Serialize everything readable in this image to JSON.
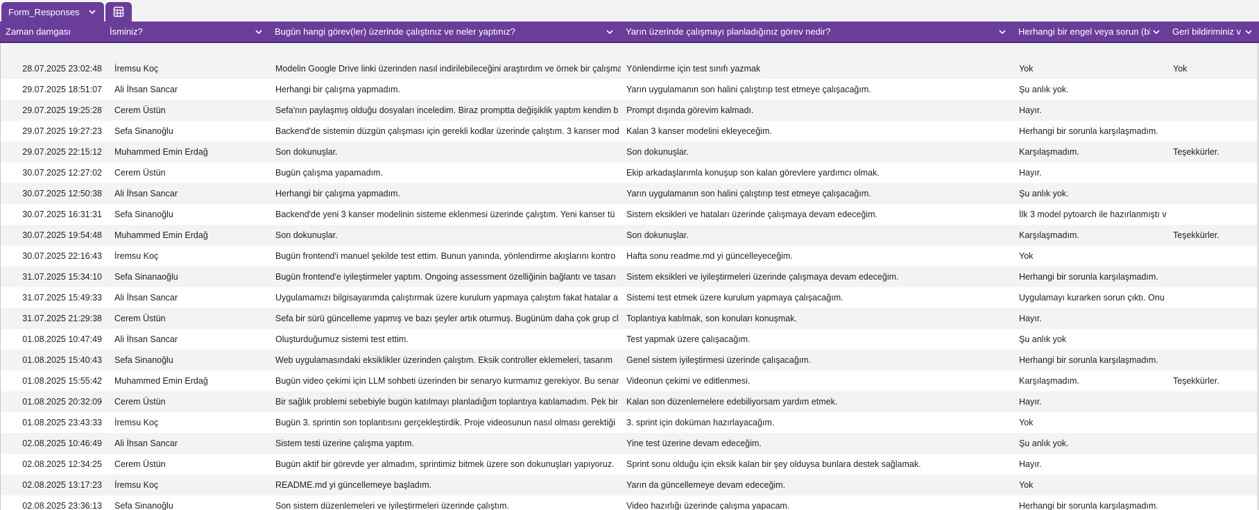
{
  "tab": {
    "name": "Form_Responses",
    "chevron_icon": "chevron-down-icon",
    "view_icon": "table-grid-icon"
  },
  "columns": [
    "Zaman damgası",
    "İsminiz?",
    "Bugün hangi görev(ler) üzerinde çalıştınız ve neler yaptınız?",
    "Yarın üzerinde çalışmayı planladığınız görev nedir?",
    "Herhangi bir engel veya sorun (bl",
    "Geri bildiriminiz v"
  ],
  "rows": [
    [
      "",
      "",
      "",
      "",
      "",
      ""
    ],
    [
      "28.07.2025 23:02:48",
      "İremsu Koç",
      "Modelin Google Drive linki üzerinden nasıl indirilebileceğini araştırdım ve örnek bir çalışma",
      "Yönlendirme için test sınıfı yazmak",
      "Yok",
      "Yok"
    ],
    [
      "29.07.2025 18:51:07",
      "Ali İhsan Sancar",
      "Herhangi bir çalışma yapmadım.",
      "Yarın uygulamanın son halini çalıştırıp test etmeye çalışacağım.",
      "Şu anlık yok.",
      ""
    ],
    [
      "29.07.2025 19:25:28",
      "Cerem Üstün",
      "Sefa'nın paylaşmış olduğu dosyaları inceledim. Biraz promptta değişiklik yaptım kendim b",
      "Prompt dışında görevim kalmadı.",
      "Hayır.",
      ""
    ],
    [
      "29.07.2025 19:27:23",
      "Sefa Sinanoğlu",
      "Backend'de sistemin düzgün çalışması için gerekli kodlar üzerinde çalıştım. 3 kanser mod",
      "Kalan 3 kanser modelini ekleyeceğim.",
      "Herhangi bir sorunla karşılaşmadım.",
      ""
    ],
    [
      "29.07.2025 22:15:12",
      "Muhammed Emin Erdağ",
      "Son dokunuşlar.",
      "Son dokunuşlar.",
      "Karşılaşmadım.",
      "Teşekkürler."
    ],
    [
      "30.07.2025 12:27:02",
      "Cerem Üstün",
      "Bugün çalışma yapamadım.",
      "Ekip arkadaşlarımla konuşup son kalan görevlere yardımcı olmak.",
      "Hayır.",
      ""
    ],
    [
      "30.07.2025 12:50:38",
      "Ali İhsan Sancar",
      "Herhangi bir çalışma yapmadım.",
      "Yarın uygulamanın son halini çalıştırıp test etmeye çalışacağım.",
      "Şu anlık yok.",
      ""
    ],
    [
      "30.07.2025 16:31:31",
      "Sefa Sinanoğlu",
      "Backend'de yeni 3 kanser modelinin sisteme eklenmesi üzerinde çalıştım. Yeni kanser tü",
      "Sistem eksikleri ve hataları üzerinde çalışmaya devam edeceğim.",
      "İlk 3 model pytoarch ile hazırlanmıştı v",
      ""
    ],
    [
      "30.07.2025 19:54:48",
      "Muhammed Emin Erdağ",
      "Son dokunuşlar.",
      "Son dokunuşlar.",
      "Karşılaşmadım.",
      "Teşekkürler."
    ],
    [
      "30.07.2025 22:16:43",
      "İremsu Koç",
      "Bugün frontend'i manuel şekilde test ettim. Bunun yanında, yönlendirme akışlarını kontro",
      "Hafta sonu readme.md yi güncelleyeceğim.",
      "Yok",
      ""
    ],
    [
      "31.07.2025 15:34:10",
      "Sefa Sinanaoğlu",
      "Bugün frontend'e iyileştirmeler yaptım. Ongoing assessment özelliğinin bağlantı ve tasarı",
      "Sistem eksikleri ve iyileştirmeleri üzerinde çalışmaya devam edeceğim.",
      "Herhangi bir sorunla karşılaşmadım.",
      ""
    ],
    [
      "31.07.2025 15:49:33",
      "Ali İhsan Sancar",
      "Uygulamamızı bilgisayarımda çalıştırmak üzere kurulum yapmaya çalıştım fakat hatalar a",
      "Sistemi test etmek üzere kurulum yapmaya çalışacağım.",
      "Uygulamayı kurarken sorun çıktı. Onu",
      ""
    ],
    [
      "31.07.2025 21:29:38",
      "Cerem Üstün",
      "Sefa bir sürü güncelleme yapmış ve bazı şeyler artık oturmuş. Bugünüm daha çok grup cl",
      "Toplantıya katılmak, son konuları konuşmak.",
      "Hayır.",
      ""
    ],
    [
      "01.08.2025 10:47:49",
      "Ali İhsan Sancar",
      "Oluşturduğumuz sistemi test ettim.",
      "Test yapmak üzere çalışacağım.",
      "Şu anlık yok",
      ""
    ],
    [
      "01.08.2025 15:40:43",
      "Sefa Sinanoğlu",
      "Web uygulamasındaki eksiklikler üzerinden çalıştım. Eksik controller eklemeleri, tasarım",
      "Genel sistem iyileştirmesi üzerinde çalışacağım.",
      "Herhangi bir sorunla karşılaşmadım.",
      ""
    ],
    [
      "01.08.2025 15:55:42",
      "Muhammed Emin Erdağ",
      "Bugün video çekimi için LLM sohbeti üzerinden bir senaryo kurmamız gerekiyor. Bu senar",
      "Videonun çekimi ve editlenmesi.",
      "Karşılaşmadım.",
      "Teşekkürler."
    ],
    [
      "01.08.2025 20:32:09",
      "Cerem Üstün",
      "Bir sağlık problemi sebebiyle bugün katılmayı planladığım toplantıya katılamadım. Pek bir",
      "Kalan son düzenlemelere edebiliyorsam yardım etmek.",
      "Hayır.",
      ""
    ],
    [
      "01.08.2025 23:43:33",
      "İremsu Koç",
      "Bugün 3. sprintin son toplantısını gerçekleştirdik. Proje videosunun nasıl olması gerektiği",
      "3. sprint için doküman hazırlayacağım.",
      "Yok",
      ""
    ],
    [
      "02.08.2025 10:46:49",
      "Ali İhsan Sancar",
      "Sistem testi üzerine çalışma yaptım.",
      "Yine test üzerine devam edeceğim.",
      "Şu anlık yok.",
      ""
    ],
    [
      "02.08.2025 12:34:25",
      "Cerem Üstün",
      "Bugün aktif bir görevde yer almadım, sprintimiz bitmek üzere son dokunuşları yapıyoruz.",
      "Sprint sonu olduğu için eksik kalan bir şey olduysa bunlara destek sağlamak.",
      "Hayır.",
      ""
    ],
    [
      "02.08.2025 13:17:23",
      "İremsu Koç",
      "README.md yi güncellemeye başladım.",
      "Yarın da güncellemeye devam edeceğim.",
      "Yok",
      ""
    ],
    [
      "02.08.2025 23:36:13",
      "Sefa Sinanoğlu",
      "Son sistem düzenlemeleri ve iyileştirmeleri üzerinde çalıştım.",
      "Video hazırlığı üzerinde çalışma yapacam.",
      "Herhangi bir sorunla karşılaşmadım.",
      ""
    ]
  ]
}
